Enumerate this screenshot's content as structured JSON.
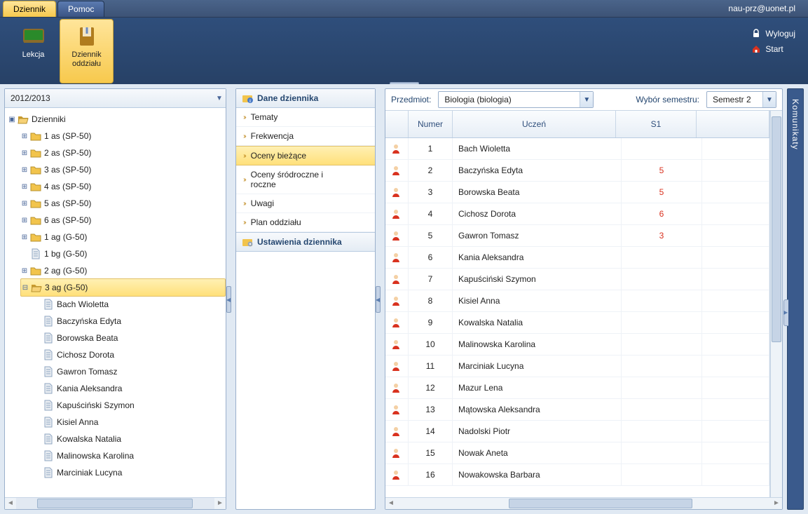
{
  "top_tabs": {
    "dziennik": "Dziennik",
    "pomoc": "Pomoc"
  },
  "user": "nau-prz@uonet.pl",
  "ribbon": {
    "lekcja": "Lekcja",
    "dziennik_oddzialu_l1": "Dziennik",
    "dziennik_oddzialu_l2": "oddziału",
    "wyloguj": "Wyloguj",
    "start": "Start"
  },
  "year_selector": "2012/2013",
  "tree_root": "Dzienniki",
  "tree_folders": [
    "1 as (SP-50)",
    "2 as (SP-50)",
    "3 as (SP-50)",
    "4 as (SP-50)",
    "5 as (SP-50)",
    "6 as (SP-50)",
    "1 ag (G-50)",
    "1 bg (G-50)",
    "2 ag (G-50)",
    "3 ag (G-50)"
  ],
  "tree_folder_collapsed": [
    true,
    true,
    true,
    true,
    true,
    true,
    true,
    false,
    true,
    false
  ],
  "tree_folder_is_doc": [
    false,
    false,
    false,
    false,
    false,
    false,
    false,
    true,
    false,
    false
  ],
  "tree_selected_index": 9,
  "tree_students": [
    "Bach Wioletta",
    "Baczyńska Edyta",
    "Borowska Beata",
    "Cichosz Dorota",
    "Gawron Tomasz",
    "Kania Aleksandra",
    "Kapuściński Szymon",
    "Kisiel Anna",
    "Kowalska Natalia",
    "Malinowska Karolina",
    "Marciniak Lucyna"
  ],
  "mid": {
    "section1": "Dane dziennika",
    "items": [
      "Tematy",
      "Frekwencja",
      "Oceny bieżące",
      "Oceny śródroczne i roczne",
      "Uwagi",
      "Plan oddziału"
    ],
    "selected_index": 2,
    "section2": "Ustawienia dziennika"
  },
  "filters": {
    "subject_label": "Przedmiot:",
    "subject_value": "Biologia (biologia)",
    "sem_label": "Wybór semestru:",
    "sem_value": "Semestr 2"
  },
  "grid": {
    "headers": {
      "numer": "Numer",
      "uczen": "Uczeń",
      "s1": "S1"
    },
    "rows": [
      {
        "num": "1",
        "name": "Bach Wioletta",
        "s1": ""
      },
      {
        "num": "2",
        "name": "Baczyńska Edyta",
        "s1": "5"
      },
      {
        "num": "3",
        "name": "Borowska Beata",
        "s1": "5"
      },
      {
        "num": "4",
        "name": "Cichosz Dorota",
        "s1": "6"
      },
      {
        "num": "5",
        "name": "Gawron Tomasz",
        "s1": "3"
      },
      {
        "num": "6",
        "name": "Kania Aleksandra",
        "s1": ""
      },
      {
        "num": "7",
        "name": "Kapuściński Szymon",
        "s1": ""
      },
      {
        "num": "8",
        "name": "Kisiel Anna",
        "s1": ""
      },
      {
        "num": "9",
        "name": "Kowalska Natalia",
        "s1": ""
      },
      {
        "num": "10",
        "name": "Malinowska Karolina",
        "s1": ""
      },
      {
        "num": "11",
        "name": "Marciniak Lucyna",
        "s1": ""
      },
      {
        "num": "12",
        "name": "Mazur Lena",
        "s1": ""
      },
      {
        "num": "13",
        "name": "Mątowska Aleksandra",
        "s1": ""
      },
      {
        "num": "14",
        "name": "Nadolski Piotr",
        "s1": ""
      },
      {
        "num": "15",
        "name": "Nowak Aneta",
        "s1": ""
      },
      {
        "num": "16",
        "name": "Nowakowska Barbara",
        "s1": ""
      }
    ]
  },
  "side": {
    "komunikaty": "Komunikaty"
  }
}
